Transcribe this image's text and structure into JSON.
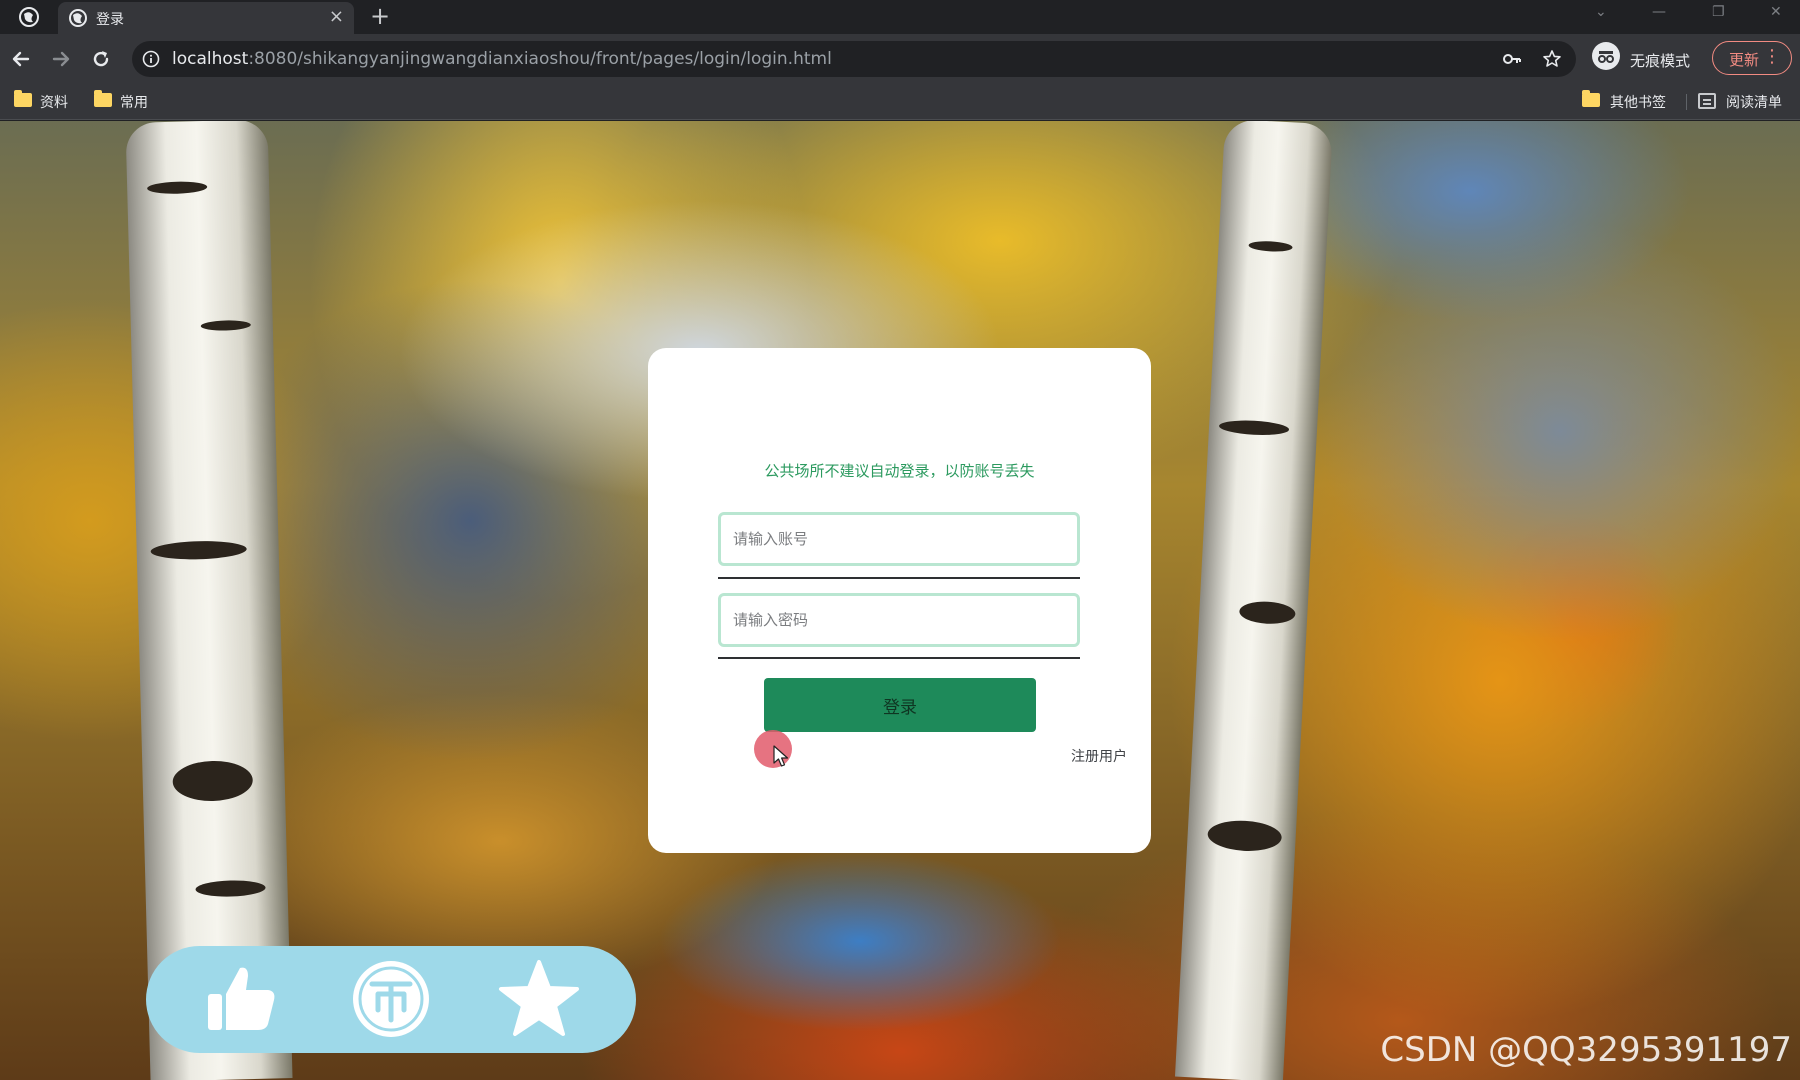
{
  "browser": {
    "tab": {
      "title": "登录",
      "close_label": "×"
    },
    "new_tab_label": "+",
    "window_controls": {
      "minimize": "—",
      "restore": "❐",
      "close": "✕",
      "tab_search": "⌄"
    },
    "address": {
      "host": "localhost",
      "rest": ":8080/shikangyanjingwangdianxiaoshou/front/pages/login/login.html"
    },
    "incognito_label": "无痕模式",
    "update_label": "更新",
    "menu_label": "⋮",
    "bookmarks": [
      {
        "label": "资料"
      },
      {
        "label": "常用"
      }
    ],
    "other_bookmarks_label": "其他书签",
    "reading_list_label": "阅读清单"
  },
  "login": {
    "hint": "公共场所不建议自动登录，以防账号丢失",
    "username_placeholder": "请输入账号",
    "password_placeholder": "请输入密码",
    "submit_label": "登录",
    "register_label": "注册用户"
  },
  "action_bar": {
    "icons": [
      "thumbs-up-icon",
      "coin-icon",
      "star-icon"
    ],
    "coin_glyph": "币"
  },
  "watermark": "CSDN @QQ3295391197",
  "colors": {
    "accent": "#1e8a5a",
    "hint": "#2c9a5f",
    "action_bar": "#9ed9e9"
  }
}
